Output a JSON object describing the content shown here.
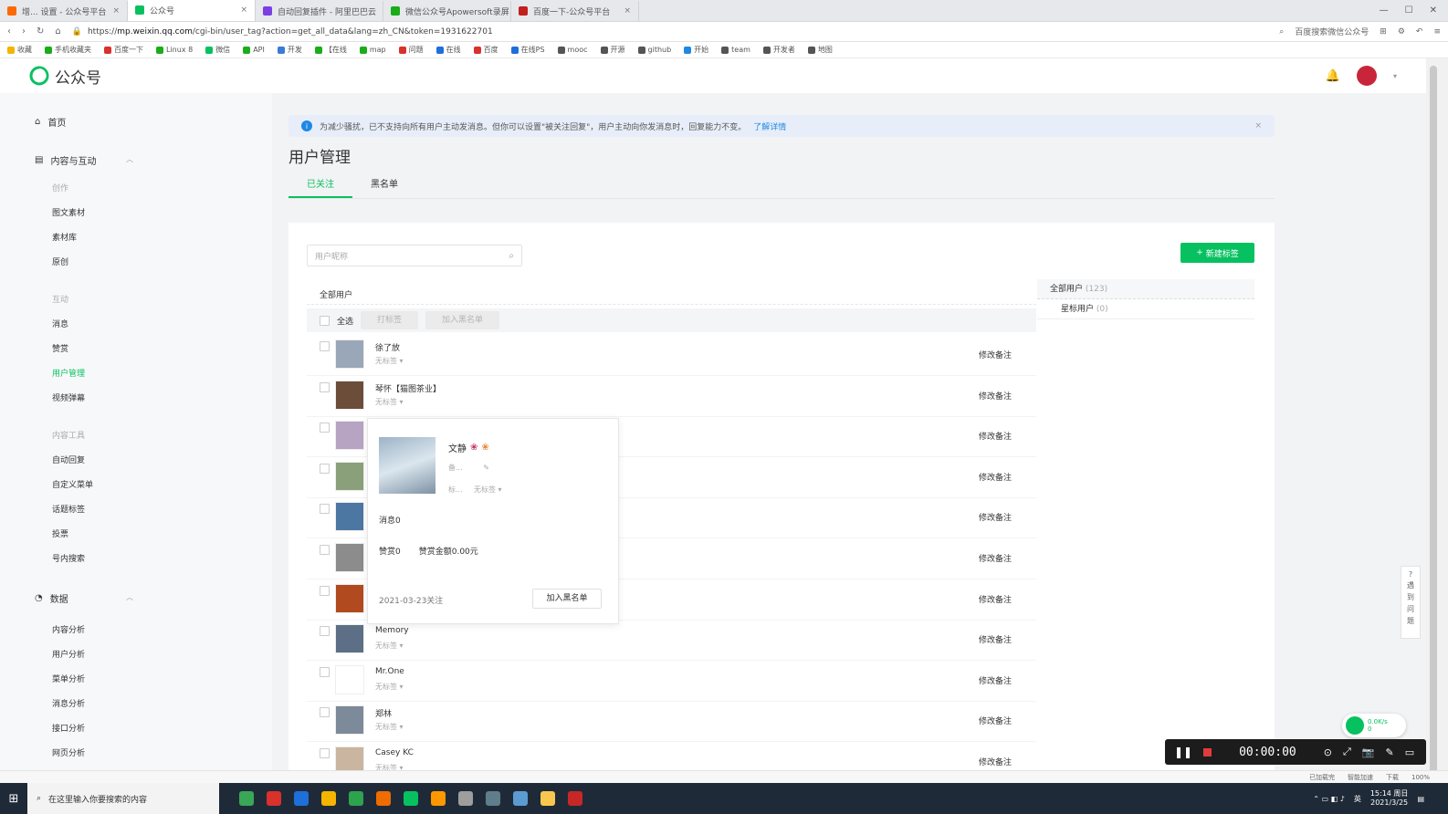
{
  "browser": {
    "tabs": [
      {
        "label": "增... 设置 - 公众号平台",
        "color": "#ff6a00"
      },
      {
        "label": "公众号",
        "color": "#07c160",
        "active": true
      },
      {
        "label": "自动回复插件 - 阿里巴巴云",
        "color": "#7b3fe4"
      },
      {
        "label": "微信公众号Apowersoft录屏",
        "color": "#1aad19"
      },
      {
        "label": "百度一下-公众号平台",
        "color": "#c21f1f"
      }
    ],
    "url_prefix": "https://",
    "url_host": "mp.weixin.qq.com",
    "url_path": "/cgi-bin/user_tag?action=get_all_data&lang=zh_CN&token=1931622701",
    "search_hint": "百度搜索微信公众号",
    "bookmarks": [
      "收藏",
      "手机收藏夹",
      "百度一下",
      "Linux 8",
      "微信",
      "API",
      "开发",
      "【在线",
      "map",
      "问题",
      "在线",
      "百度",
      "在线PS",
      "mooc",
      "开源",
      "github",
      "开始",
      "team",
      "开发者",
      "地图"
    ]
  },
  "app": {
    "title": "公众号"
  },
  "sidebar": {
    "home": "首页",
    "content": "内容与互动",
    "create_group": "创作",
    "create_items": [
      "图文素材",
      "素材库",
      "原创"
    ],
    "interact_group": "互动",
    "interact_items": [
      "消息",
      "赞赏",
      "用户管理",
      "视频弹幕"
    ],
    "tools_group": "内容工具",
    "tools_items": [
      "自动回复",
      "自定义菜单",
      "话题标签",
      "投票",
      "号内搜索"
    ],
    "data": "数据",
    "data_items": [
      "内容分析",
      "用户分析",
      "菜单分析",
      "消息分析",
      "接口分析",
      "网页分析"
    ]
  },
  "main": {
    "notice": "为减少骚扰，已不支持向所有用户主动发消息。但你可以设置\"被关注回复\"，用户主动向你发消息时，回复能力不变。",
    "notice_link": "了解详情",
    "page_title": "用户管理",
    "tab_followed": "已关注",
    "tab_blacklist": "黑名单",
    "search_placeholder": "用户昵称",
    "new_tag": "新建标签",
    "list_title": "全部用户",
    "select_all": "全选",
    "btn_tag": "打标签",
    "btn_blacklist": "加入黑名单",
    "users": [
      {
        "name": "徐了放",
        "tag": "无标签",
        "remark": "修改备注"
      },
      {
        "name": "琴怀【猫图茶业】",
        "tag": "无标签",
        "remark": "修改备注"
      },
      {
        "name": "",
        "tag": "",
        "remark": "修改备注"
      },
      {
        "name": "",
        "tag": "",
        "remark": "修改备注"
      },
      {
        "name": "",
        "tag": "",
        "remark": "修改备注"
      },
      {
        "name": "",
        "tag": "",
        "remark": "修改备注"
      },
      {
        "name": "",
        "tag": "",
        "remark": "修改备注"
      },
      {
        "name": "Memory",
        "tag": "无标签",
        "remark": "修改备注"
      },
      {
        "name": "Mr.One",
        "tag": "无标签",
        "remark": "修改备注"
      },
      {
        "name": "郑林",
        "tag": "无标签",
        "remark": "修改备注"
      },
      {
        "name": "Casey KC",
        "tag": "无标签",
        "remark": "修改备注"
      }
    ],
    "tag_all": "全部用户",
    "tag_all_count": "(123)",
    "tag_star": "星标用户",
    "tag_star_count": "(0)"
  },
  "popup": {
    "name": "文静",
    "remark_label": "备...",
    "tag_label": "标...",
    "tag_value": "无标签",
    "messages": "消息0",
    "rewards": "赞赏0",
    "reward_amount": "赞赏金额0.00元",
    "follow_date": "2021-03-23关注",
    "blacklist_btn": "加入黑名单"
  },
  "overlay": {
    "help": [
      "?",
      "遇",
      "到",
      "问",
      "题"
    ],
    "net_up": "0.0K/s",
    "net_down": "0",
    "recorder_time": "00:00:00"
  },
  "statusbar": [
    "已加载完",
    "智能加速",
    "下载",
    "100%"
  ],
  "taskbar": {
    "search": "在这里输入你要搜索的内容",
    "time": "15:14 周日",
    "date": "2021/3/25",
    "ime": "英"
  }
}
